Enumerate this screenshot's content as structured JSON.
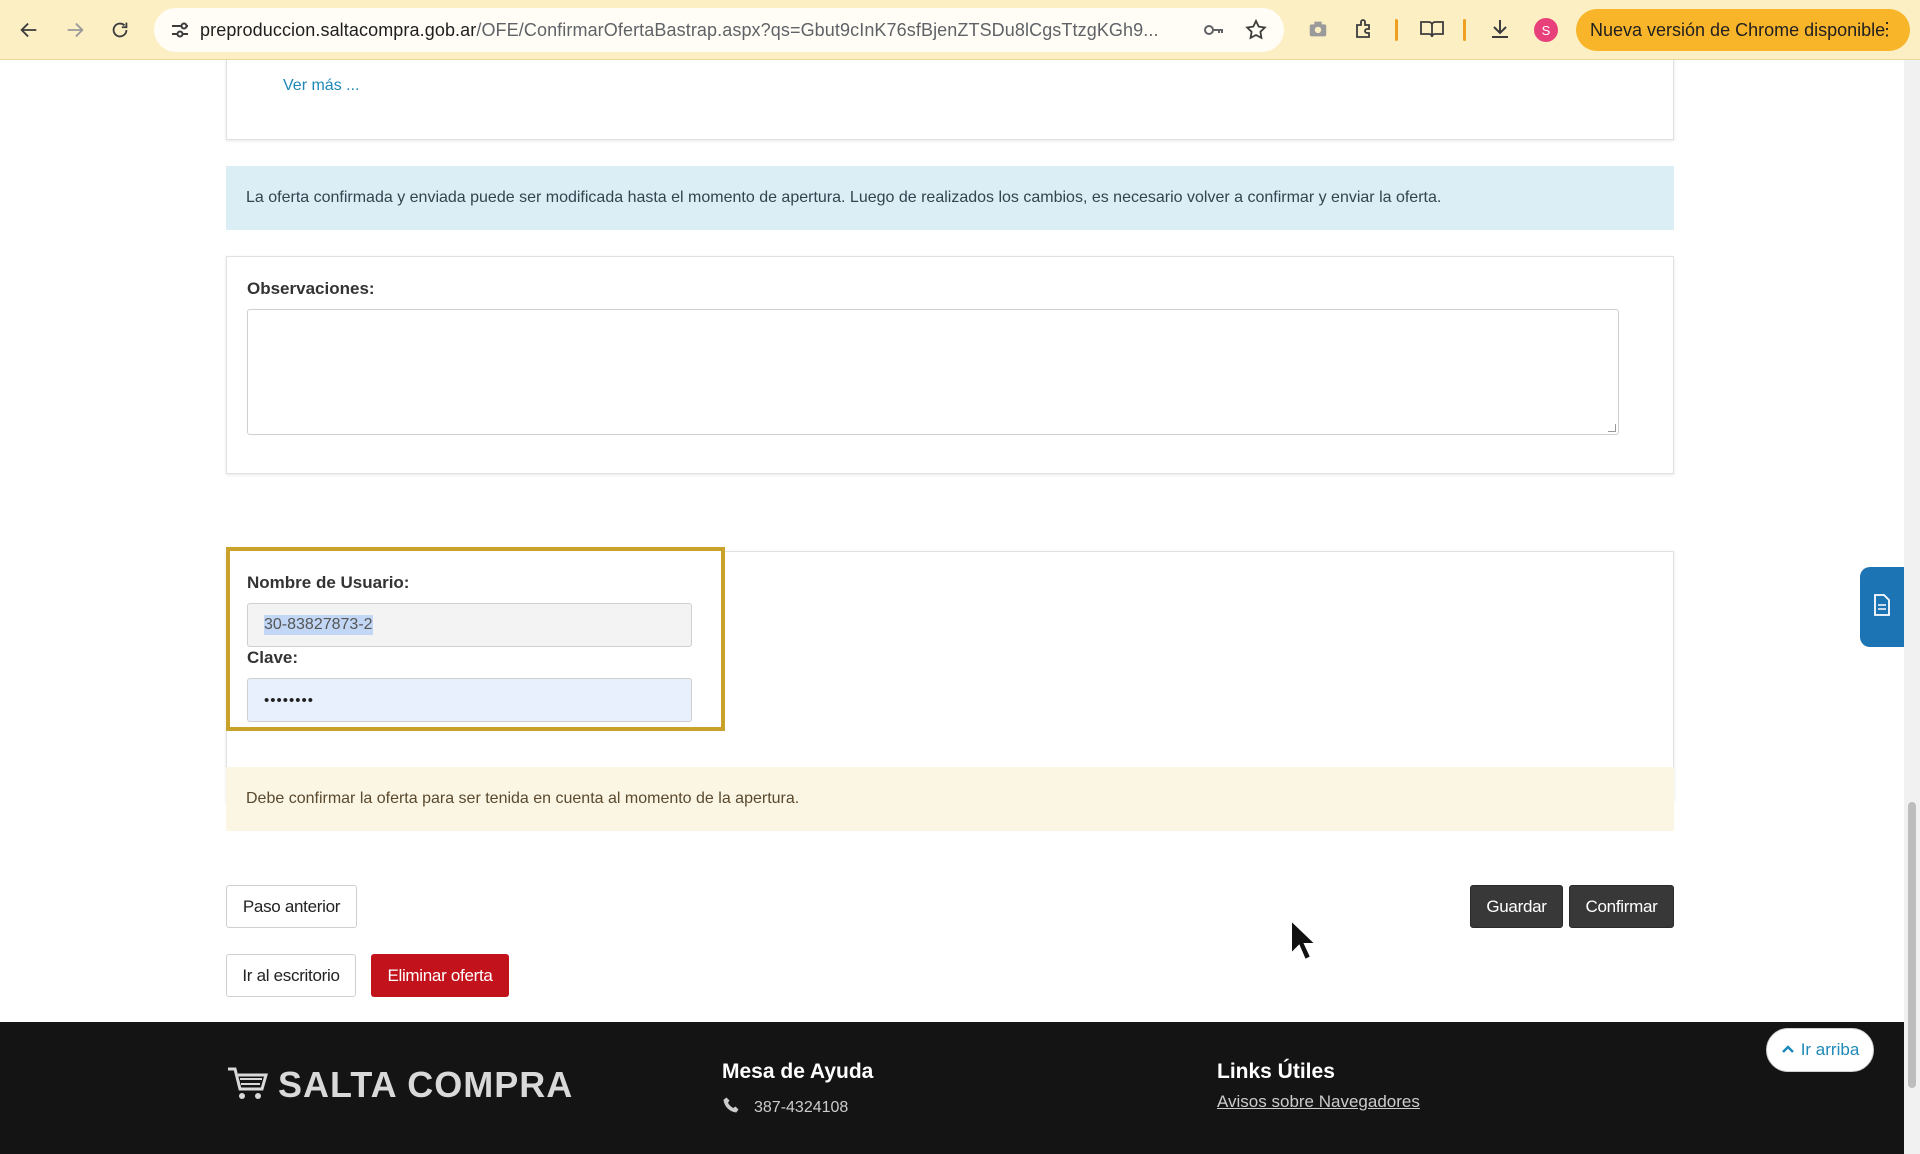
{
  "browser": {
    "url_host": "preproduccion.saltacompra.gob.ar",
    "url_path": "/OFE/ConfirmarOfertaBastrap.aspx?qs=Gbut9cInK76sfBjenZTSDu8lCgsTtzgKGh9...",
    "profile_initial": "S",
    "update_label": "Nueva versión de Chrome disponible",
    "accent_color": "#f9b52a"
  },
  "page": {
    "see_more_label": "Ver más ...",
    "info_alert": "La oferta confirmada y enviada puede ser modificada hasta el momento de apertura. Luego de realizados los cambios, es necesario volver a confirmar y enviar la oferta.",
    "observations_label": "Observaciones:",
    "observations_value": "",
    "username_label": "Nombre de Usuario:",
    "username_value": "30-83827873-2",
    "password_label": "Clave:",
    "password_value": "••••••••",
    "warning_alert": "Debe confirmar la oferta para ser tenida en cuenta al momento de la apertura.",
    "buttons": {
      "previous": "Paso anterior",
      "save": "Guardar",
      "confirm": "Confirmar",
      "desktop": "Ir al escritorio",
      "delete": "Eliminar oferta"
    },
    "highlight_color": "#c9a22b"
  },
  "footer": {
    "brand": "SALTA COMPRA",
    "help_title": "Mesa de Ayuda",
    "help_phone": "387-4324108",
    "links_title": "Links Útiles",
    "link_browsers": "Avisos sobre Navegadores",
    "back_to_top": "Ir arriba"
  }
}
